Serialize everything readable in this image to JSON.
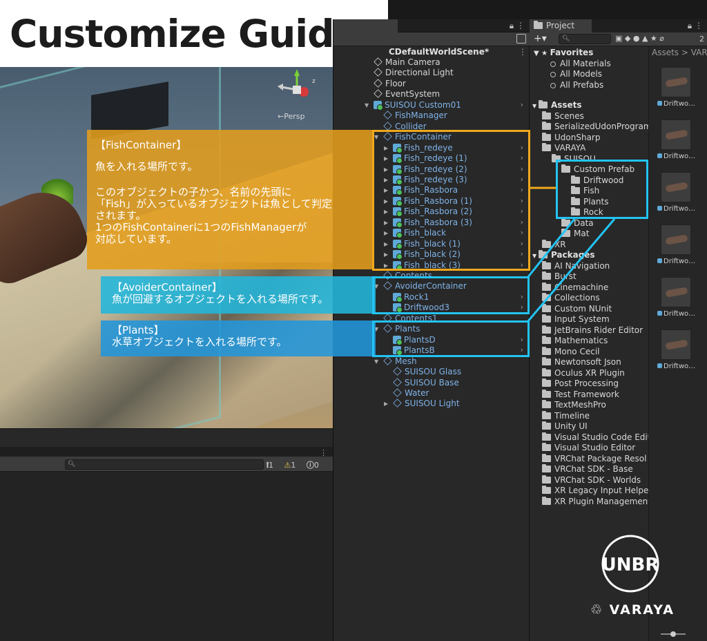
{
  "title": "Customize Guide",
  "scene": {
    "persp_label": "←Persp",
    "gizmo_axis": "z"
  },
  "hierarchy": {
    "scene_name": "CDefaultWorldScene*",
    "rows": [
      {
        "label": "Main Camera",
        "kind": "cube",
        "color": "white",
        "depth": 1
      },
      {
        "label": "Directional Light",
        "kind": "cube",
        "color": "white",
        "depth": 1
      },
      {
        "label": "Floor",
        "kind": "cube",
        "color": "white",
        "depth": 1
      },
      {
        "label": "EventSystem",
        "kind": "cube",
        "color": "white",
        "depth": 1
      },
      {
        "label": "SUISOU Custom01",
        "kind": "prefab",
        "color": "blue",
        "depth": 1
      },
      {
        "label": "FishManager",
        "kind": "cube",
        "color": "blue",
        "depth": 2
      },
      {
        "label": "Collider",
        "kind": "cube",
        "color": "blue",
        "depth": 2
      },
      {
        "label": "FishContainer",
        "kind": "cube",
        "color": "blue",
        "depth": 2
      },
      {
        "label": "Fish_redeye",
        "kind": "prefab",
        "color": "blue",
        "depth": 3
      },
      {
        "label": "Fish_redeye (1)",
        "kind": "prefab",
        "color": "blue",
        "depth": 3
      },
      {
        "label": "Fish_redeye (2)",
        "kind": "prefab",
        "color": "blue",
        "depth": 3
      },
      {
        "label": "Fish_redeye (3)",
        "kind": "prefab",
        "color": "blue",
        "depth": 3
      },
      {
        "label": "Fish_Rasbora",
        "kind": "prefab",
        "color": "blue",
        "depth": 3
      },
      {
        "label": "Fish_Rasbora (1)",
        "kind": "prefab",
        "color": "blue",
        "depth": 3
      },
      {
        "label": "Fish_Rasbora (2)",
        "kind": "prefab",
        "color": "blue",
        "depth": 3
      },
      {
        "label": "Fish_Rasbora (3)",
        "kind": "prefab",
        "color": "blue",
        "depth": 3
      },
      {
        "label": "Fish_black",
        "kind": "prefab",
        "color": "blue",
        "depth": 3
      },
      {
        "label": "Fish_black (1)",
        "kind": "prefab",
        "color": "blue",
        "depth": 3
      },
      {
        "label": "Fish_black (2)",
        "kind": "prefab",
        "color": "blue",
        "depth": 3
      },
      {
        "label": "Fish_black (3)",
        "kind": "prefab",
        "color": "blue",
        "depth": 3
      },
      {
        "label": "Contents",
        "kind": "cube",
        "color": "blue",
        "depth": 2
      },
      {
        "label": "AvoiderContainer",
        "kind": "cube",
        "color": "blue",
        "depth": 2
      },
      {
        "label": "Rock1",
        "kind": "prefab",
        "color": "blue",
        "depth": 3
      },
      {
        "label": "Driftwood3",
        "kind": "prefab",
        "color": "blue",
        "depth": 3
      },
      {
        "label": "Contents1",
        "kind": "cube",
        "color": "blue",
        "depth": 2
      },
      {
        "label": "Plants",
        "kind": "cube",
        "color": "blue",
        "depth": 2
      },
      {
        "label": "PlantsD",
        "kind": "prefab",
        "color": "blue",
        "depth": 3
      },
      {
        "label": "PlantsB",
        "kind": "prefab",
        "color": "blue",
        "depth": 3
      },
      {
        "label": "Mesh",
        "kind": "cube",
        "color": "blue",
        "depth": 2
      },
      {
        "label": "SUISOU Glass",
        "kind": "cube",
        "color": "blue",
        "depth": 3
      },
      {
        "label": "SUISOU Base",
        "kind": "cube",
        "color": "blue",
        "depth": 3
      },
      {
        "label": "Water",
        "kind": "cube",
        "color": "blue",
        "depth": 3
      },
      {
        "label": "SUISOU Light",
        "kind": "cube",
        "color": "blue",
        "depth": 3
      }
    ]
  },
  "project": {
    "tab_label": "Project",
    "counter": "2",
    "breadcrumb": "Assets > VAR",
    "favorites_label": "Favorites",
    "favorites": [
      "All Materials",
      "All Models",
      "All Prefabs"
    ],
    "assets_label": "Assets",
    "assets": [
      {
        "label": "Scenes",
        "depth": 1
      },
      {
        "label": "SerializedUdonProgram",
        "depth": 1
      },
      {
        "label": "UdonSharp",
        "depth": 1
      },
      {
        "label": "VARAYA",
        "depth": 1
      },
      {
        "label": "SUISOU",
        "depth": 2
      },
      {
        "label": "Custom Prefab",
        "depth": 3
      },
      {
        "label": "Driftwood",
        "depth": 4
      },
      {
        "label": "Fish",
        "depth": 4
      },
      {
        "label": "Plants",
        "depth": 4
      },
      {
        "label": "Rock",
        "depth": 4
      },
      {
        "label": "Data",
        "depth": 3
      },
      {
        "label": "Mat",
        "depth": 3
      },
      {
        "label": "XR",
        "depth": 1
      }
    ],
    "packages_label": "Packages",
    "packages": [
      "AI Navigation",
      "Burst",
      "Cinemachine",
      "Collections",
      "Custom NUnit",
      "Input System",
      "JetBrains Rider Editor",
      "Mathematics",
      "Mono Cecil",
      "Newtonsoft Json",
      "Oculus XR Plugin",
      "Post Processing",
      "Test Framework",
      "TextMeshPro",
      "Timeline",
      "Unity UI",
      "Visual Studio Code Edit",
      "Visual Studio Editor",
      "VRChat Package Resol",
      "VRChat SDK - Base",
      "VRChat SDK - Worlds",
      "XR Legacy Input Helpe",
      "XR Plugin Management"
    ],
    "thumbnail_label": "Driftwo…",
    "thumbnails": 6
  },
  "console": {
    "counts": {
      "messages": "1",
      "warnings": "1",
      "errors": "0"
    }
  },
  "callouts": {
    "fish": {
      "heading": "【FishContainer】",
      "line1": "魚を入れる場所です。",
      "line2": "このオブジェクトの子かつ、名前の先頭に",
      "line3": "「Fish」が入っているオブジェクトは魚として判定",
      "line4": "されます。",
      "line5": "1つのFishContainerに1つのFishManagerが",
      "line6": "対応しています。"
    },
    "avoider": {
      "heading": "【AvoiderContainer】",
      "line1": "魚が回避するオブジェクトを入れる場所です。"
    },
    "plants": {
      "heading": "【Plants】",
      "line1": "水草オブジェクトを入れる場所です。"
    }
  },
  "logos": {
    "unbr": "UNBR",
    "varaya": "VARAYA"
  },
  "colors": {
    "orange": "#f0a81c",
    "cyan": "#22c4f4",
    "hier_blue": "#7fb3e8"
  }
}
